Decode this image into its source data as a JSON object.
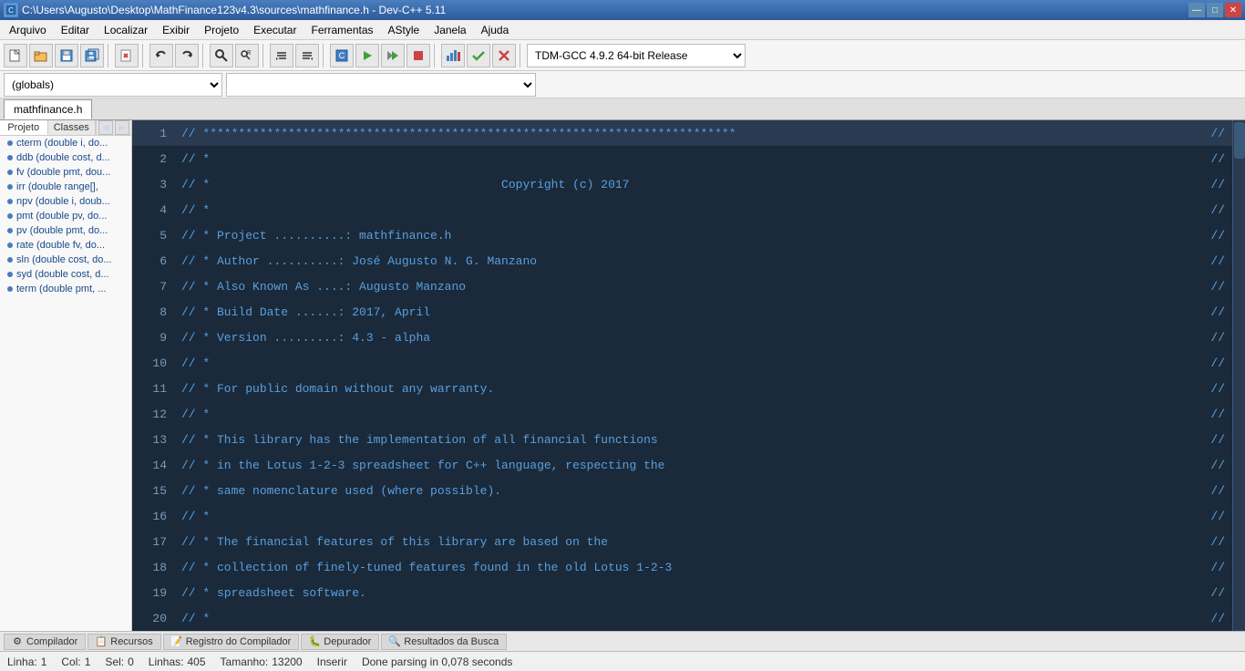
{
  "titlebar": {
    "title": "C:\\Users\\Augusto\\Desktop\\MathFinance123v4.3\\sources\\mathfinance.h - Dev-C++ 5.11",
    "minimize": "—",
    "maximize": "□",
    "close": "✕"
  },
  "menubar": {
    "items": [
      {
        "label": "Arquivo"
      },
      {
        "label": "Editar"
      },
      {
        "label": "Localizar"
      },
      {
        "label": "Exibir"
      },
      {
        "label": "Projeto"
      },
      {
        "label": "Executar"
      },
      {
        "label": "Ferramentas"
      },
      {
        "label": "AStyle"
      },
      {
        "label": "Janela"
      },
      {
        "label": "Ajuda"
      }
    ]
  },
  "toolbar": {
    "dropdown1": "(globals)",
    "dropdown2": ""
  },
  "tabs": {
    "active": "mathfinance.h"
  },
  "sidebar": {
    "tab1": "Projeto",
    "tab2": "Classes",
    "items": [
      {
        "label": "cterm (double i, do..."
      },
      {
        "label": "ddb (double cost, d..."
      },
      {
        "label": "fv (double pmt, dou..."
      },
      {
        "label": "irr (double range[],"
      },
      {
        "label": "npv (double i, doub..."
      },
      {
        "label": "pmt (double pv, do..."
      },
      {
        "label": "pv (double pmt, do..."
      },
      {
        "label": "rate (double fv, do..."
      },
      {
        "label": "sln (double cost, do..."
      },
      {
        "label": "syd (double cost, d..."
      },
      {
        "label": "term (double pmt, ..."
      }
    ]
  },
  "code": {
    "lines": [
      {
        "num": 1,
        "code": "// ***************************************************************************",
        "end": "//"
      },
      {
        "num": 2,
        "code": "// *                                                                         ",
        "end": "//"
      },
      {
        "num": 3,
        "code": "// *                                         Copyright (c) 2017             ",
        "end": "//"
      },
      {
        "num": 4,
        "code": "// *                                                                         ",
        "end": "//"
      },
      {
        "num": 5,
        "code": "// * Project ..........: mathfinance.h                                       ",
        "end": "//"
      },
      {
        "num": 6,
        "code": "// * Author ..........: José Augusto N. G. Manzano                          ",
        "end": "//"
      },
      {
        "num": 7,
        "code": "// * Also Known As ....: Augusto Manzano                                    ",
        "end": "//"
      },
      {
        "num": 8,
        "code": "// * Build Date ......: 2017, April                                          ",
        "end": "//"
      },
      {
        "num": 9,
        "code": "// * Version .........: 4.3 - alpha                                          ",
        "end": "//"
      },
      {
        "num": 10,
        "code": "// *                                                                         ",
        "end": "//"
      },
      {
        "num": 11,
        "code": "// * For public domain without any warranty.                                 ",
        "end": "//"
      },
      {
        "num": 12,
        "code": "// *                                                                         ",
        "end": "//"
      },
      {
        "num": 13,
        "code": "// * This library has the implementation of all financial functions          ",
        "end": "//"
      },
      {
        "num": 14,
        "code": "// * in the Lotus 1-2-3 spreadsheet for C++ language, respecting the        ",
        "end": "//"
      },
      {
        "num": 15,
        "code": "// * same nomenclature used (where possible).                                ",
        "end": "//"
      },
      {
        "num": 16,
        "code": "// *                                                                         ",
        "end": "//"
      },
      {
        "num": 17,
        "code": "// * The financial features of this library are based on the                 ",
        "end": "//"
      },
      {
        "num": 18,
        "code": "// * collection of finely-tuned features found in the old Lotus 1-2-3       ",
        "end": "//"
      },
      {
        "num": 19,
        "code": "// * spreadsheet software.                                                   ",
        "end": "//"
      },
      {
        "num": 20,
        "code": "// *                                                                         ",
        "end": "//"
      }
    ]
  },
  "statusbar": {
    "line_label": "Linha:",
    "line_value": "1",
    "col_label": "Col:",
    "col_value": "1",
    "sel_label": "Sel:",
    "sel_value": "0",
    "lines_label": "Linhas:",
    "lines_value": "405",
    "size_label": "Tamanho:",
    "size_value": "13200",
    "insert_label": "Inserir",
    "status_text": "Done parsing in 0,078 seconds"
  },
  "bottomtabs": [
    {
      "label": "Compilador",
      "icon": "⚙"
    },
    {
      "label": "Recursos",
      "icon": "📋"
    },
    {
      "label": "Registro do Compilador",
      "icon": "📝"
    },
    {
      "label": "Depurador",
      "icon": "🐛"
    },
    {
      "label": "Resultados da Busca",
      "icon": "🔍"
    }
  ]
}
